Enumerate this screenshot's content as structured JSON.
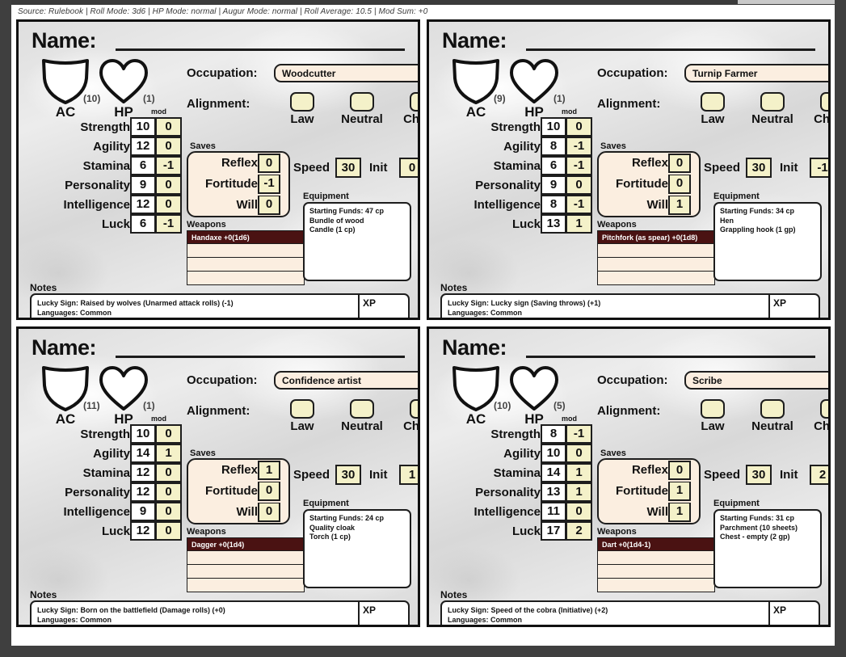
{
  "meta_bar": "Source: Rulebook | Roll Mode: 3d6 | HP Mode: normal | Augur Mode: normal | Roll Average: 10.5 | Mod Sum: +0",
  "labels": {
    "name": "Name:",
    "ac": "AC",
    "hp": "HP",
    "occupation": "Occupation:",
    "alignment": "Alignment:",
    "mod": "mod",
    "saves": "Saves",
    "speed": "Speed",
    "init": "Init",
    "weapons": "Weapons",
    "equipment": "Equipment",
    "notes": "Notes",
    "xp": "XP",
    "attributes": [
      "Strength",
      "Agility",
      "Stamina",
      "Personality",
      "Intelligence",
      "Luck"
    ],
    "saves_names": [
      "Reflex",
      "Fortitude",
      "Will"
    ],
    "alignments": [
      "Law",
      "Neutral",
      "Chaos"
    ]
  },
  "colors": {
    "sheet_border": "#111111",
    "field_cream": "#fbeee0",
    "mod_yellow": "#f4f1c9",
    "weapon_filled": "#4a1212",
    "frame_dark": "#3f3f3f"
  },
  "sheets": [
    {
      "ac": "(10)",
      "hp": "(1)",
      "occupation": "Woodcutter",
      "alignment_selected": "",
      "attributes": [
        {
          "name": "Strength",
          "value": "10",
          "mod": "0"
        },
        {
          "name": "Agility",
          "value": "12",
          "mod": "0"
        },
        {
          "name": "Stamina",
          "value": "6",
          "mod": "-1"
        },
        {
          "name": "Personality",
          "value": "9",
          "mod": "0"
        },
        {
          "name": "Intelligence",
          "value": "12",
          "mod": "0"
        },
        {
          "name": "Luck",
          "value": "6",
          "mod": "-1"
        }
      ],
      "saves": [
        {
          "name": "Reflex",
          "value": "0"
        },
        {
          "name": "Fortitude",
          "value": "-1"
        },
        {
          "name": "Will",
          "value": "0"
        }
      ],
      "speed": "30",
      "init": "0",
      "weapons": [
        "Handaxe +0(1d6)",
        "",
        "",
        ""
      ],
      "equipment": [
        "Starting Funds: 47 cp",
        "Bundle of wood",
        "Candle (1 cp)"
      ],
      "notes": [
        "Lucky Sign: Raised by wolves (Unarmed attack rolls) (-1)",
        "Languages: Common"
      ]
    },
    {
      "ac": "(9)",
      "hp": "(1)",
      "occupation": "Turnip Farmer",
      "alignment_selected": "",
      "attributes": [
        {
          "name": "Strength",
          "value": "10",
          "mod": "0"
        },
        {
          "name": "Agility",
          "value": "8",
          "mod": "-1"
        },
        {
          "name": "Stamina",
          "value": "6",
          "mod": "-1"
        },
        {
          "name": "Personality",
          "value": "9",
          "mod": "0"
        },
        {
          "name": "Intelligence",
          "value": "8",
          "mod": "-1"
        },
        {
          "name": "Luck",
          "value": "13",
          "mod": "1"
        }
      ],
      "saves": [
        {
          "name": "Reflex",
          "value": "0"
        },
        {
          "name": "Fortitude",
          "value": "0"
        },
        {
          "name": "Will",
          "value": "1"
        }
      ],
      "speed": "30",
      "init": "-1",
      "weapons": [
        "Pitchfork (as spear) +0(1d8)",
        "",
        "",
        ""
      ],
      "equipment": [
        "Starting Funds: 34 cp",
        "Hen",
        "Grappling hook (1 gp)"
      ],
      "notes": [
        "Lucky Sign: Lucky sign (Saving throws) (+1)",
        "Languages: Common"
      ]
    },
    {
      "ac": "(11)",
      "hp": "(1)",
      "occupation": "Confidence artist",
      "alignment_selected": "",
      "attributes": [
        {
          "name": "Strength",
          "value": "10",
          "mod": "0"
        },
        {
          "name": "Agility",
          "value": "14",
          "mod": "1"
        },
        {
          "name": "Stamina",
          "value": "12",
          "mod": "0"
        },
        {
          "name": "Personality",
          "value": "12",
          "mod": "0"
        },
        {
          "name": "Intelligence",
          "value": "9",
          "mod": "0"
        },
        {
          "name": "Luck",
          "value": "12",
          "mod": "0"
        }
      ],
      "saves": [
        {
          "name": "Reflex",
          "value": "1"
        },
        {
          "name": "Fortitude",
          "value": "0"
        },
        {
          "name": "Will",
          "value": "0"
        }
      ],
      "speed": "30",
      "init": "1",
      "weapons": [
        "Dagger +0(1d4)",
        "",
        "",
        ""
      ],
      "equipment": [
        "Starting Funds: 24 cp",
        "Quality cloak",
        "Torch (1 cp)"
      ],
      "notes": [
        "Lucky Sign: Born on the battlefield (Damage rolls) (+0)",
        "Languages: Common"
      ]
    },
    {
      "ac": "(10)",
      "hp": "(5)",
      "occupation": "Scribe",
      "alignment_selected": "",
      "attributes": [
        {
          "name": "Strength",
          "value": "8",
          "mod": "-1"
        },
        {
          "name": "Agility",
          "value": "10",
          "mod": "0"
        },
        {
          "name": "Stamina",
          "value": "14",
          "mod": "1"
        },
        {
          "name": "Personality",
          "value": "13",
          "mod": "1"
        },
        {
          "name": "Intelligence",
          "value": "11",
          "mod": "0"
        },
        {
          "name": "Luck",
          "value": "17",
          "mod": "2"
        }
      ],
      "saves": [
        {
          "name": "Reflex",
          "value": "0"
        },
        {
          "name": "Fortitude",
          "value": "1"
        },
        {
          "name": "Will",
          "value": "1"
        }
      ],
      "speed": "30",
      "init": "2",
      "weapons": [
        "Dart +0(1d4-1)",
        "",
        "",
        ""
      ],
      "equipment": [
        "Starting Funds: 31 cp",
        "Parchment (10 sheets)",
        "Chest - empty (2 gp)"
      ],
      "notes": [
        "Lucky Sign: Speed of the cobra (Initiative) (+2)",
        "Languages: Common"
      ]
    }
  ]
}
